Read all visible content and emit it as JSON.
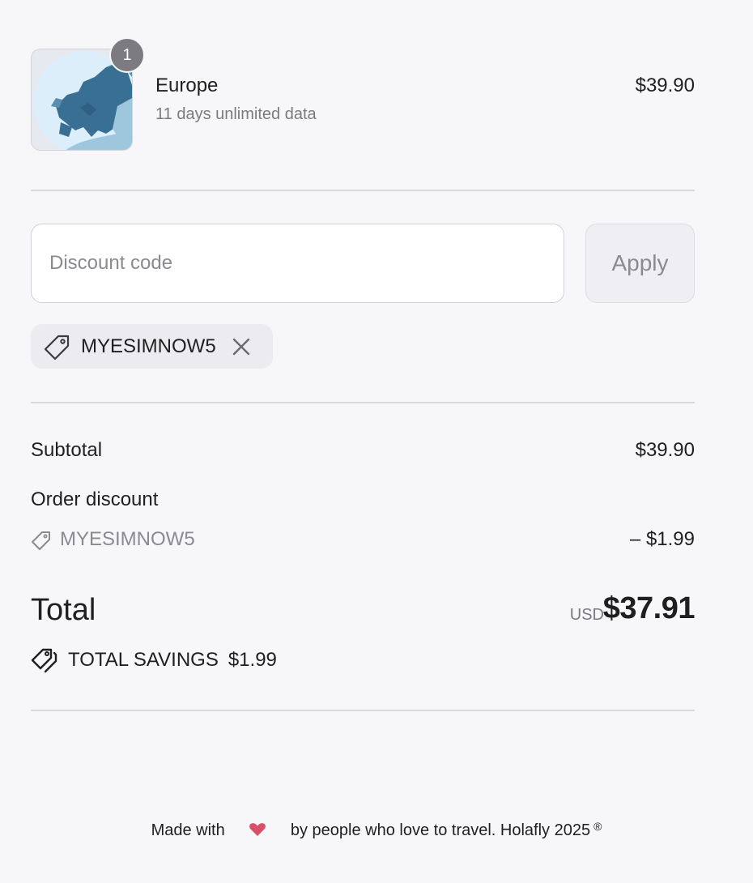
{
  "product": {
    "name": "Europe",
    "description": "11 days unlimited data",
    "price": "$39.90",
    "quantity": "1",
    "image_icon": "europe-globe-icon"
  },
  "discount": {
    "placeholder": "Discount code",
    "apply_label": "Apply",
    "applied_code": "MYESIMNOW5",
    "tag_icon": "tag-icon",
    "remove_icon": "close-icon"
  },
  "summary": {
    "subtotal_label": "Subtotal",
    "subtotal_value": "$39.90",
    "order_discount_label": "Order discount",
    "discount_code": "MYESIMNOW5",
    "discount_value": "– $1.99",
    "total_label": "Total",
    "currency": "USD",
    "total_value": "$37.91",
    "savings_label": "TOTAL SAVINGS",
    "savings_value": "$1.99"
  },
  "footer": {
    "text_before": "Made with",
    "text_after": "by people who love to travel. Holafly 2025",
    "registered": "®",
    "heart_color": "#d9506a"
  }
}
